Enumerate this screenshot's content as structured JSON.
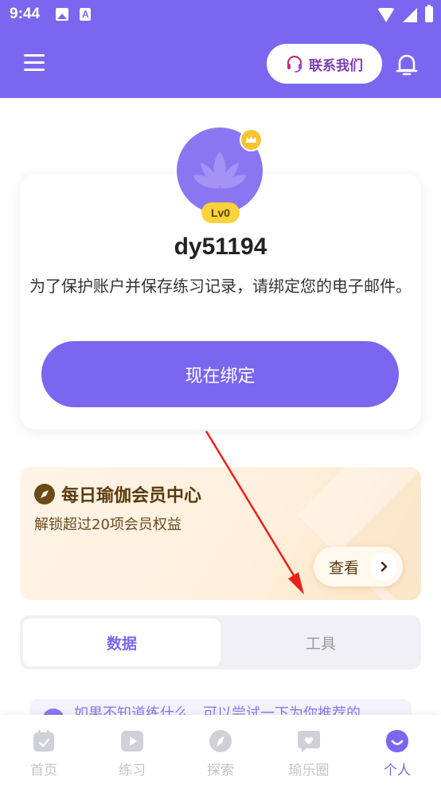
{
  "status_bar": {
    "time": "9:44",
    "icons": [
      "gallery-icon",
      "text-icon",
      "wifi-icon",
      "signal-icon",
      "battery-icon"
    ]
  },
  "header": {
    "menu_icon": "hamburger-menu-icon",
    "contact_button": {
      "label": "联系我们",
      "icon": "headset-icon"
    },
    "notification_icon": "bell-icon"
  },
  "profile": {
    "username": "dy51194",
    "level": "Lv0",
    "bind_hint": "为了保护账户并保存练习记录，请绑定您的电子邮件。",
    "bind_button": "现在绑定"
  },
  "vip": {
    "title": "每日瑜伽会员中心",
    "subtitle": "解锁超过20项会员权益",
    "view_button": "查看"
  },
  "tabs": [
    {
      "label": "数据",
      "active": true
    },
    {
      "label": "工具",
      "active": false
    }
  ],
  "recommendation": {
    "text": "如果不知道练什么，可以尝试一下为你推荐的"
  },
  "bottom_nav": [
    {
      "label": "首页",
      "icon": "calendar-icon",
      "active": false
    },
    {
      "label": "练习",
      "icon": "play-icon",
      "active": false
    },
    {
      "label": "探索",
      "icon": "compass-icon",
      "active": false
    },
    {
      "label": "瑜乐圈",
      "icon": "heart-chat-icon",
      "active": false
    },
    {
      "label": "个人",
      "icon": "smile-face-icon",
      "active": true
    }
  ],
  "colors": {
    "primary": "#7B66F0",
    "vip_text": "#5A3A0C",
    "level_badge": "#FCD23A",
    "annotation_arrow": "#E8211A"
  }
}
